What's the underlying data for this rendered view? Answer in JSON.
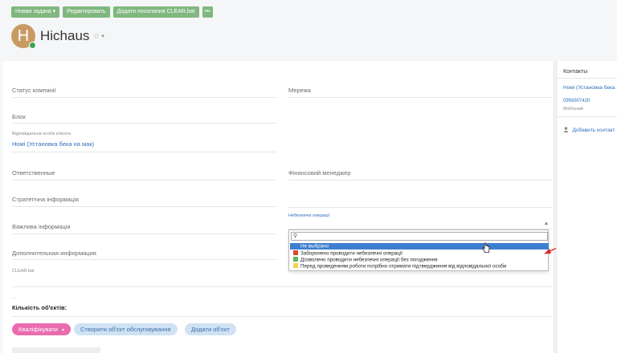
{
  "toolbar": {
    "new_task": "Новая задача ▾",
    "edit": "Редактировать",
    "add_link": "Додати посилання CLEAR.bat",
    "more": "•••"
  },
  "header": {
    "avatar_letter": "H",
    "title": "Hichaus",
    "star": "☆",
    "chevron": "▾"
  },
  "fields": {
    "status_label": "Статус компанії",
    "network_label": "Мережа",
    "block_label": "Блок",
    "responsible_client_label": "Відповідальна особа клієнта",
    "responsible_client_value": "Номі (Установка бека на мак)",
    "responsible_label": "Ответственные",
    "finance_manager_label": "Фінансовий менеджер",
    "strategic_label": "Стратегічна інформація",
    "important_label": "Важлива інформація",
    "dangerous_label": "Небезпечні операції",
    "additional_label": "Дополнительная информация",
    "clearbat_label": "CLEAR.bat",
    "dots": "..",
    "objects_count_label": "Кількість об'єктів:"
  },
  "dropdown": {
    "options": [
      {
        "label": "Не выбрано",
        "color": ""
      },
      {
        "label": "Заборонено проводити небезпечні операції",
        "color": "#e0452b"
      },
      {
        "label": "Дозволено проводити небезпечні операції без погодження",
        "color": "#5bb85d"
      },
      {
        "label": "Перед проведенням роботи потрібно отримати підтвердження від відповідальної особи",
        "color": "#f3d34a"
      }
    ]
  },
  "actions": {
    "qualify": "Кваліфікувати",
    "qualify_chevron": "▾",
    "create_object": "Створити об'єкт обслуговування",
    "add_object": "Додати об'єкт"
  },
  "contacts": {
    "title": "Контакты",
    "contact_name": "Номі (Установка бека",
    "phone": "0956907420",
    "phone_type": "Мобільний",
    "add_contact": "Добавить контакт"
  },
  "colors": {
    "toolbar_green": "#7fb77e",
    "link_blue": "#2f6fbf",
    "qualify_pink": "#e86cae",
    "light_blue_button": "#cfe2f3",
    "selected_option": "#3c7fd1",
    "arrow_red": "#d9262c"
  }
}
